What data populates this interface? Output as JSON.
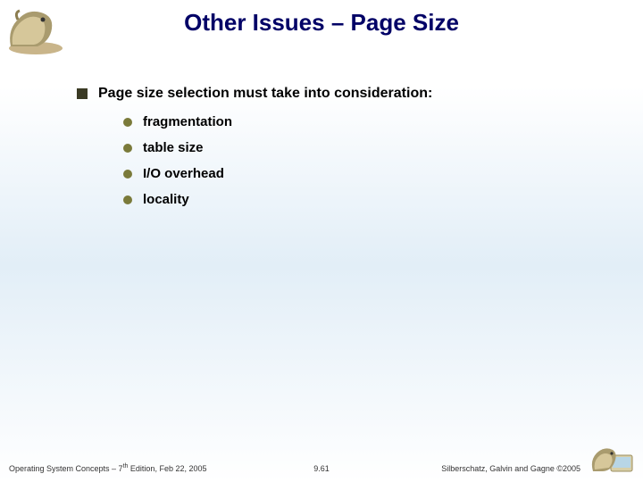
{
  "title": "Other Issues – Page Size",
  "content": {
    "lead": "Page size selection must take into consideration:",
    "items": [
      "fragmentation",
      "table size",
      "I/O overhead",
      "locality"
    ]
  },
  "footer": {
    "left_prefix": "Operating System Concepts – 7",
    "left_sup": "th",
    "left_suffix": " Edition, Feb 22, 2005",
    "center": "9.61",
    "right": "Silberschatz, Galvin and Gagne ©2005"
  },
  "icons": {
    "dino_top": "dinosaur-mascot-icon",
    "dino_bottom": "dinosaur-mascot-small-icon"
  }
}
